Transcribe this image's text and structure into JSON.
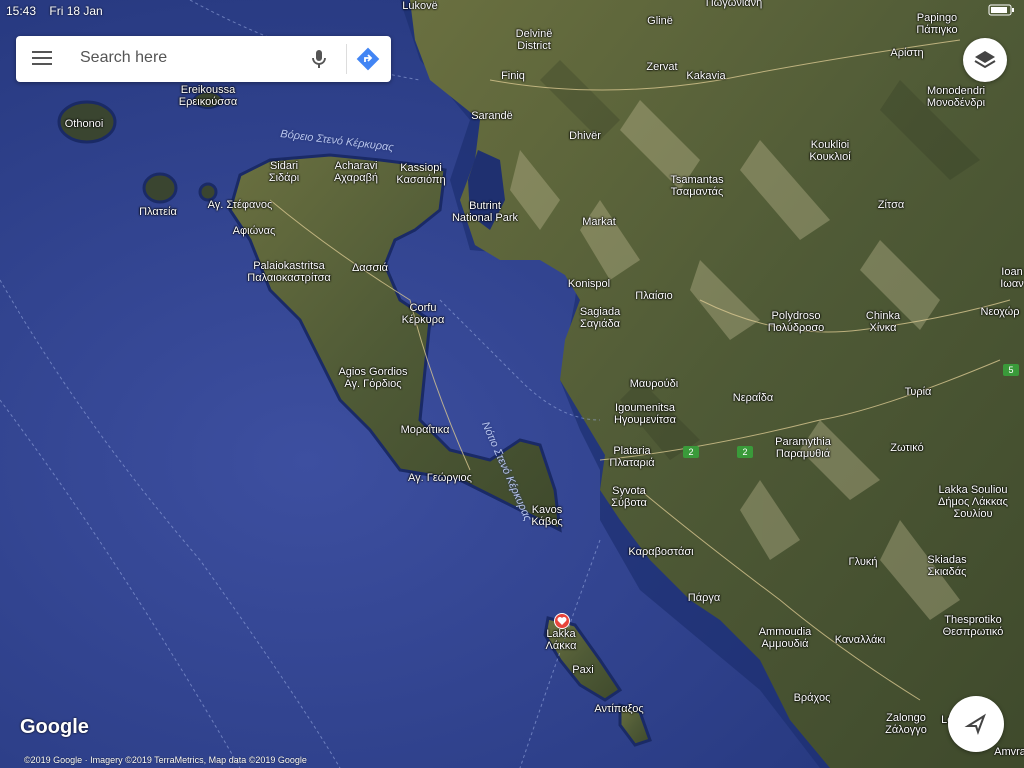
{
  "status_bar": {
    "time": "15:43",
    "date": "Fri 18 Jan"
  },
  "search": {
    "placeholder": "Search here"
  },
  "attribution": {
    "logo": "Google",
    "text": "©2019 Google · Imagery ©2019 TerraMetrics, Map data ©2019 Google"
  },
  "labels": {
    "lukove": "Lukovë",
    "pogoniani": "Πωγωνιανη",
    "papingo": "Papingo\nΠάπιγκο",
    "delvine": "Delvinë\nDistrict",
    "gline": "Glinë",
    "aristi": "Αρίστη",
    "finiq": "Finiq",
    "zervat": "Zervat",
    "kakavia": "Kakavia",
    "monodendri": "Monodendri\nΜονοδένδρι",
    "ereikoussa": "Ereikoussa\nΕρεικούσσα",
    "othonoi": "Othonoi",
    "sarande": "Sarandë",
    "dhiver": "Dhivër",
    "kouklioi": "Koukliοi\nΚουκλιοί",
    "sidari": "Sidari\nΣιδάρι",
    "acharavi": "Acharavi\nΑχαραβή",
    "kassiopi": "Kassiopi\nΚασσιόπη",
    "tsamantas": "Tsamantas\nΤσαμαντάς",
    "plateia": "Πλατεία",
    "agstefanos": "Αγ. Στέφανος",
    "butrint": "Butrint\nNational Park",
    "zitsa": "Ζίτσα",
    "markat": "Markat",
    "afionas": "Αφιώνας",
    "palaiokastritsa": "Palaiokastritsa\nΠαλαιοκαστρίτσα",
    "dassia": "Δασσιά",
    "konispol": "Konispol",
    "ioan": "Ioan\nΙωαν",
    "plaisio": "Πλαίσιο",
    "sagiada": "Sagiada\nΣαγιάδα",
    "corfu": "Corfu\nΚέρκυρα",
    "polydroso": "Polydroso\nΠολύδροσο",
    "chinka": "Chinka\nΧίνκα",
    "neochori": "Νεοχώρ",
    "agiosgordios": "Agios Gordios\nΑγ. Γόρδιος",
    "mavroudi": "Μαυρούδι",
    "tyria": "Τυρία",
    "igoumenitsa": "Igoumenitsa\nΗγουμενίτσα",
    "neraida": "Νεραΐδα",
    "moraitika": "Μοραΐτικα",
    "paramythia": "Paramythia\nΠαραμυθιά",
    "zotiko": "Ζωτικό",
    "plataria": "Plataria\nΠλαταριά",
    "aggeorgios": "Αγ. Γεώργιος",
    "syvota": "Syvota\nΣύβοτα",
    "lakkasouliou": "Lakka Souliou\nΔήμος Λάκκας\nΣουλίου",
    "kavos": "Kavos\nΚάβος",
    "karavostasi": "Καραβοστάσι",
    "glyki": "Γλυκή",
    "skiadas": "Skiadas\nΣκιαδάς",
    "parga": "Πάργα",
    "lakka": "Lakka\nΛάκκα",
    "ammoudia": "Ammoudia\nΑμμουδιά",
    "kanallaki": "Καναλλάκι",
    "thesprotiko": "Thesprotiko\nΘεσπρωτικό",
    "paxi": "Paxi",
    "vrachos": "Βράχος",
    "antipaxos": "Αντίπαξος",
    "louros": "Louros",
    "zalongo": "Zalongo\nΖάλογγο",
    "amvra": "Amvra"
  },
  "sea_labels": {
    "north_strait": "Βόρειο Στενό Κέρκυρας",
    "south_strait": "Νότιο Στενό Κέρκυρας"
  },
  "road_numbers": {
    "r1": "2",
    "r2": "2",
    "r3": "5"
  },
  "colors": {
    "sea": "#2b3f86",
    "land": "#4f5a36",
    "accent": "#4285f4",
    "pin": "#e8453c"
  },
  "icons": [
    "menu-icon",
    "mic-icon",
    "directions-icon",
    "layers-icon",
    "navigation-arrow-icon",
    "heart-pin-icon"
  ]
}
